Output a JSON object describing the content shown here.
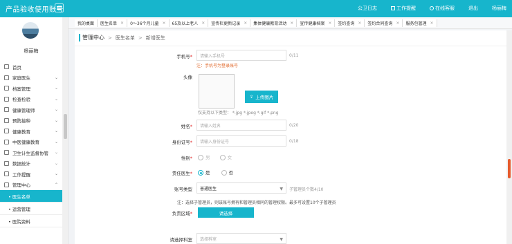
{
  "header": {
    "app_title": "产品验收使用账号",
    "nav": [
      {
        "label": "公卫日志",
        "icon": "none"
      },
      {
        "label": "工作提醒",
        "icon": "bell-icon"
      },
      {
        "label": "在线客服",
        "icon": "headset-icon"
      },
      {
        "label": "退出",
        "icon": "none"
      },
      {
        "label": "杨丽梅",
        "icon": "none"
      }
    ]
  },
  "sidebar": {
    "user_name": "杨丽梅",
    "items": [
      {
        "label": "首页",
        "icon": "home-icon",
        "has_children": false
      },
      {
        "label": "家庭医生",
        "icon": "doctor-icon",
        "has_children": true
      },
      {
        "label": "档案管理",
        "icon": "archive-icon",
        "has_children": true
      },
      {
        "label": "检查检验",
        "icon": "test-icon",
        "has_children": true
      },
      {
        "label": "健康管理师",
        "icon": "health-icon",
        "has_children": true
      },
      {
        "label": "预防接种",
        "icon": "vaccine-icon",
        "has_children": true
      },
      {
        "label": "健康教育",
        "icon": "education-icon",
        "has_children": true
      },
      {
        "label": "中医健康教育",
        "icon": "tcm-icon",
        "has_children": true
      },
      {
        "label": "卫生计生监督协管",
        "icon": "supervise-icon",
        "has_children": true
      },
      {
        "label": "数据统计",
        "icon": "stats-icon",
        "has_children": true
      },
      {
        "label": "工作提醒",
        "icon": "reminder-icon",
        "has_children": true
      },
      {
        "label": "管理中心",
        "icon": "settings-icon",
        "has_children": true
      }
    ],
    "sub_items": [
      {
        "label": "• 医生名单",
        "active": true
      },
      {
        "label": "• 运营管理",
        "active": false
      },
      {
        "label": "• 医院资料",
        "active": false
      }
    ]
  },
  "tabs": [
    {
      "label": "我的桌面",
      "closable": false
    },
    {
      "label": "医生名单",
      "closable": true
    },
    {
      "label": "0～36个月儿童",
      "closable": true
    },
    {
      "label": "65及以上老人",
      "closable": true
    },
    {
      "label": "宣传栏更新记录",
      "closable": true
    },
    {
      "label": "集体健康教育活动",
      "closable": true
    },
    {
      "label": "宣传健康档案",
      "closable": true
    },
    {
      "label": "签约查询",
      "closable": true
    },
    {
      "label": "签约合同查询",
      "closable": true
    },
    {
      "label": "服务包管理",
      "closable": true
    }
  ],
  "breadcrumb": {
    "root": "管理中心",
    "items": [
      "医生名单",
      "新增医生"
    ],
    "separator": ">"
  },
  "form": {
    "phone": {
      "label": "手机号",
      "placeholder": "请输入手机号",
      "counter": "0/11",
      "note": "注：手机号为登录账号"
    },
    "avatar": {
      "label": "头像",
      "upload_button": "上传图片",
      "hint": "仅支持以下类型： *.jpg *.jpeg *.gif *.png"
    },
    "name": {
      "label": "姓名",
      "placeholder": "请输入姓名",
      "counter": "0/20"
    },
    "id_card": {
      "label": "身份证号",
      "placeholder": "请输入身份证号",
      "counter": "0/18"
    },
    "gender": {
      "label": "性别",
      "options": [
        "男",
        "女"
      ]
    },
    "responsible_doctor": {
      "label": "责任医生",
      "options": [
        "是",
        "否"
      ],
      "selected": "是"
    },
    "account_type": {
      "label": "账号类型",
      "value": "普通医生",
      "hint": "子管理员个数4/10"
    },
    "account_note": "注：选择子管理员，则该账号拥有和管理员相同的管理权限。最多可设置10个子管理员",
    "region": {
      "label": "负责区域",
      "button": "请选择"
    },
    "department": {
      "label": "请选择科室",
      "placeholder": "选择科室"
    }
  },
  "colors": {
    "accent": "#17b5cc",
    "warning": "#e0682a",
    "required": "#e02020"
  }
}
